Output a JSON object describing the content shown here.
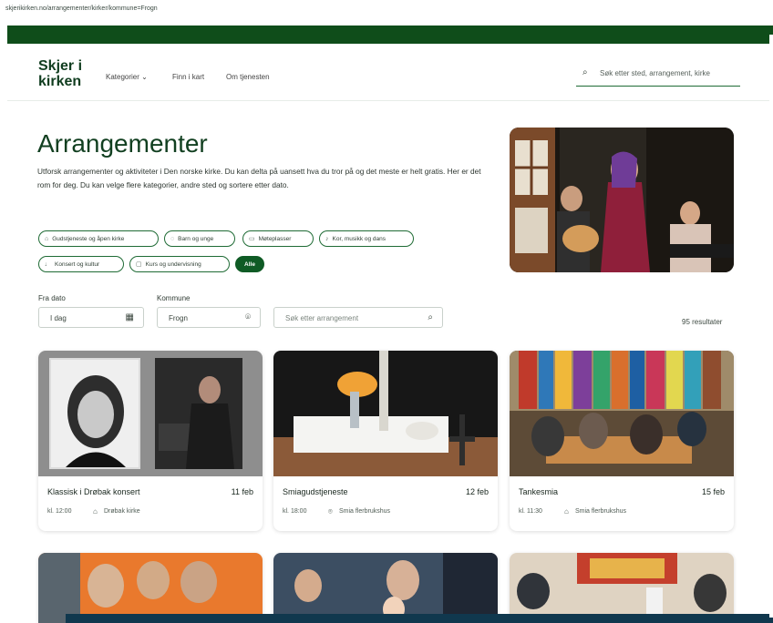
{
  "url": "skjerikirken.no/arrangementer/kirker/kommune=Frogn",
  "logo": {
    "line1": "Skjer i",
    "line2": "kirken"
  },
  "nav": {
    "categories": "Kategorier",
    "map": "Finn i kart",
    "about": "Om tjenesten"
  },
  "top_search": {
    "placeholder": "Søk etter sted, arrangement, kirke"
  },
  "hero": {
    "title": "Arrangementer",
    "text": "Utforsk arrangementer og aktiviteter i Den norske kirke. Du kan delta på uansett hva du tror på og det meste er helt gratis. Her er det rom for deg. Du kan velge flere kategorier, andre sted og sortere etter dato."
  },
  "chips": [
    {
      "label": "Gudstjeneste og åpen kirke",
      "icon": "church-icon"
    },
    {
      "label": "Barn og unge",
      "icon": "speech-icon"
    },
    {
      "label": "Møteplasser",
      "icon": "message-icon"
    },
    {
      "label": "Kor, musikk og dans",
      "icon": "music-icon"
    },
    {
      "label": "Konsert og kultur",
      "icon": "mic-icon"
    },
    {
      "label": "Kurs og undervisning",
      "icon": "book-icon"
    },
    {
      "label": "Alle",
      "icon": ""
    }
  ],
  "filters": {
    "from_label": "Fra dato",
    "from_value": "I dag",
    "municipality_label": "Kommune",
    "municipality_value": "Frogn",
    "search_placeholder": "Søk etter arrangement"
  },
  "results": "95 resultater",
  "cards": [
    {
      "title": "Klassisk i Drøbak konsert",
      "date": "11 feb",
      "time": "kl. 12:00",
      "location": "Drøbak kirke"
    },
    {
      "title": "Smiagudstjeneste",
      "date": "12 feb",
      "time": "kl. 18:00",
      "location": "Smia flerbrukshus"
    },
    {
      "title": "Tankesmia",
      "date": "15 feb",
      "time": "kl. 11:30",
      "location": "Smia flerbrukshus"
    }
  ],
  "colors": {
    "brand": "#0f4d1a",
    "active_chip": "#0f5b25"
  }
}
